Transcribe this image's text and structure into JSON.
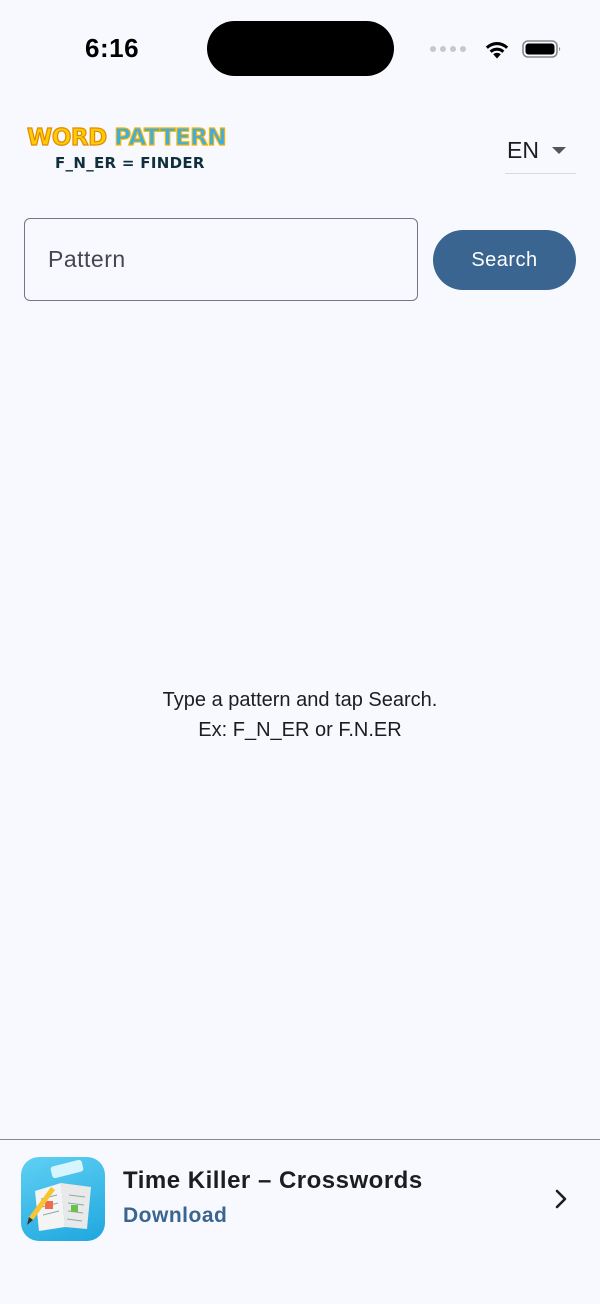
{
  "status_bar": {
    "time": "6:16"
  },
  "header": {
    "logo_line1_word": "WORD",
    "logo_line1_pattern": "PATTERN",
    "logo_line2": "F_N_ER = FINDER",
    "language": "EN"
  },
  "search": {
    "placeholder": "Pattern",
    "value": "",
    "button_label": "Search"
  },
  "hint": {
    "line1": "Type a pattern and tap Search.",
    "line2": "Ex: F_N_ER or F.N.ER"
  },
  "banner": {
    "title": "Time Killer – Crosswords",
    "action": "Download"
  },
  "colors": {
    "background": "#f8f9fe",
    "primary": "#3a6590",
    "logo_yellow": "#ffcb05",
    "logo_blue": "#3aaee8"
  }
}
